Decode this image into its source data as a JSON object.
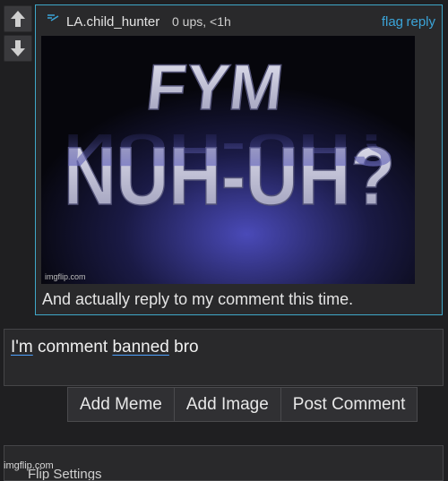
{
  "vote": {
    "up_icon": "arrow-up-icon",
    "down_icon": "arrow-down-icon"
  },
  "comment": {
    "user_icon": "user-hunter-icon",
    "username": "LA.child_hunter",
    "meta": "0 ups, <1h",
    "flag_label": "flag",
    "reply_label": "reply",
    "image": {
      "line1": "FYM",
      "line2": "NUH-UH?",
      "watermark": "imgflip.com"
    },
    "text": "And actually reply to my comment this time."
  },
  "reply_input": {
    "word1": "I'm",
    "word2": "comment",
    "word3": "banned",
    "word4": "bro"
  },
  "actions": {
    "add_meme": "Add Meme",
    "add_image": "Add Image",
    "post_comment": "Post Comment"
  },
  "footer": {
    "watermark": "imgflip.com",
    "partial_text": "Flip Settings"
  },
  "colors": {
    "link": "#3ba4d8",
    "border_accent": "#3fa7c8"
  }
}
